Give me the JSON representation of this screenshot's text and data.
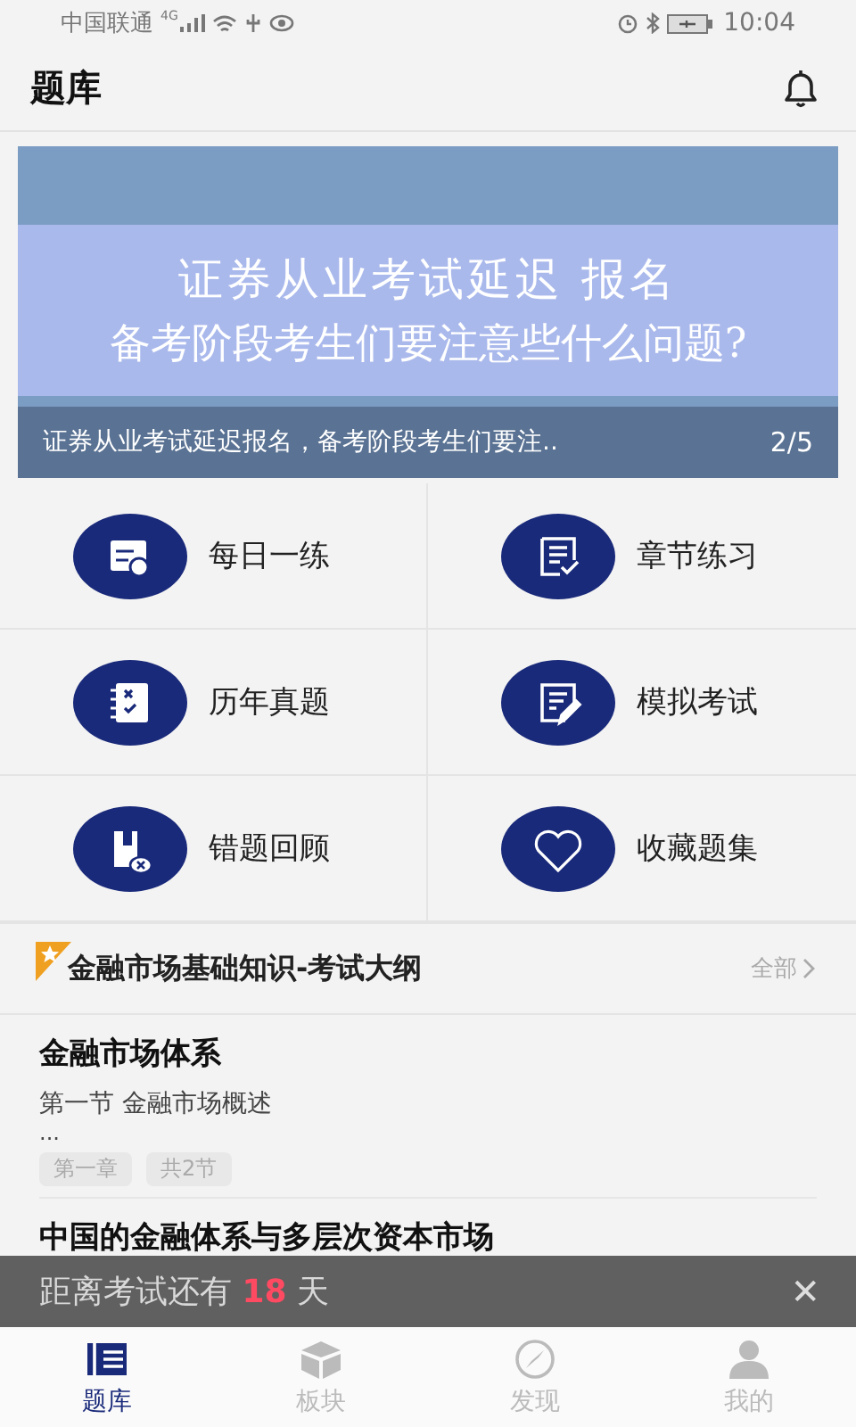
{
  "status_bar": {
    "carrier": "中国联通",
    "network": "4G",
    "time": "10:04"
  },
  "header": {
    "title": "题库"
  },
  "banner": {
    "image_lines": [
      "证券从业考试延迟 报名",
      "备考阶段考生们要注意些什么问题?"
    ],
    "caption": "证券从业考试延迟报名，备考阶段考生们要注..",
    "counter": "2/5"
  },
  "menu": [
    {
      "label": "每日一练",
      "kind": "calendar"
    },
    {
      "label": "章节练习",
      "kind": "checklist"
    },
    {
      "label": "历年真题",
      "kind": "notebook"
    },
    {
      "label": "模拟考试",
      "kind": "edit"
    },
    {
      "label": "错题回顾",
      "kind": "wrong"
    },
    {
      "label": "收藏题集",
      "kind": "heart"
    }
  ],
  "section": {
    "title": "金融市场基础知识-考试大纲",
    "more": "全部"
  },
  "chapters": [
    {
      "title": "金融市场体系",
      "subtitle": "第一节 金融市场概述",
      "ellipsis": "...",
      "tags": [
        "第一章",
        "共2节"
      ]
    },
    {
      "title": "中国的金融体系与多层次资本市场"
    }
  ],
  "countdown": {
    "before": "距离考试还有",
    "days": "18",
    "after": "天",
    "close": "✕"
  },
  "tabs": [
    {
      "label": "题库",
      "kind": "bank",
      "selected": true
    },
    {
      "label": "板块",
      "kind": "box",
      "selected": false
    },
    {
      "label": "发现",
      "kind": "compass",
      "selected": false
    },
    {
      "label": "我的",
      "kind": "person",
      "selected": false
    }
  ]
}
